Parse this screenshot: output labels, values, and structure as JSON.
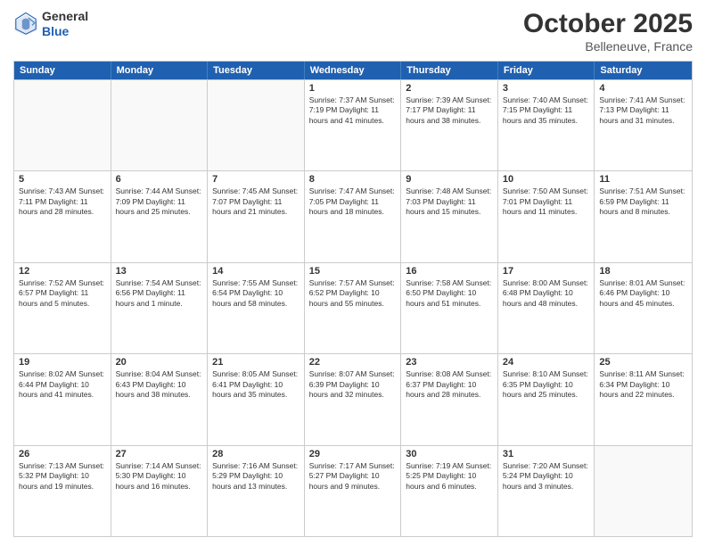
{
  "header": {
    "logo": {
      "general": "General",
      "blue": "Blue"
    },
    "title": "October 2025",
    "location": "Belleneuve, France"
  },
  "days_of_week": [
    "Sunday",
    "Monday",
    "Tuesday",
    "Wednesday",
    "Thursday",
    "Friday",
    "Saturday"
  ],
  "weeks": [
    [
      {
        "day": "",
        "info": ""
      },
      {
        "day": "",
        "info": ""
      },
      {
        "day": "",
        "info": ""
      },
      {
        "day": "1",
        "info": "Sunrise: 7:37 AM\nSunset: 7:19 PM\nDaylight: 11 hours\nand 41 minutes."
      },
      {
        "day": "2",
        "info": "Sunrise: 7:39 AM\nSunset: 7:17 PM\nDaylight: 11 hours\nand 38 minutes."
      },
      {
        "day": "3",
        "info": "Sunrise: 7:40 AM\nSunset: 7:15 PM\nDaylight: 11 hours\nand 35 minutes."
      },
      {
        "day": "4",
        "info": "Sunrise: 7:41 AM\nSunset: 7:13 PM\nDaylight: 11 hours\nand 31 minutes."
      }
    ],
    [
      {
        "day": "5",
        "info": "Sunrise: 7:43 AM\nSunset: 7:11 PM\nDaylight: 11 hours\nand 28 minutes."
      },
      {
        "day": "6",
        "info": "Sunrise: 7:44 AM\nSunset: 7:09 PM\nDaylight: 11 hours\nand 25 minutes."
      },
      {
        "day": "7",
        "info": "Sunrise: 7:45 AM\nSunset: 7:07 PM\nDaylight: 11 hours\nand 21 minutes."
      },
      {
        "day": "8",
        "info": "Sunrise: 7:47 AM\nSunset: 7:05 PM\nDaylight: 11 hours\nand 18 minutes."
      },
      {
        "day": "9",
        "info": "Sunrise: 7:48 AM\nSunset: 7:03 PM\nDaylight: 11 hours\nand 15 minutes."
      },
      {
        "day": "10",
        "info": "Sunrise: 7:50 AM\nSunset: 7:01 PM\nDaylight: 11 hours\nand 11 minutes."
      },
      {
        "day": "11",
        "info": "Sunrise: 7:51 AM\nSunset: 6:59 PM\nDaylight: 11 hours\nand 8 minutes."
      }
    ],
    [
      {
        "day": "12",
        "info": "Sunrise: 7:52 AM\nSunset: 6:57 PM\nDaylight: 11 hours\nand 5 minutes."
      },
      {
        "day": "13",
        "info": "Sunrise: 7:54 AM\nSunset: 6:56 PM\nDaylight: 11 hours\nand 1 minute."
      },
      {
        "day": "14",
        "info": "Sunrise: 7:55 AM\nSunset: 6:54 PM\nDaylight: 10 hours\nand 58 minutes."
      },
      {
        "day": "15",
        "info": "Sunrise: 7:57 AM\nSunset: 6:52 PM\nDaylight: 10 hours\nand 55 minutes."
      },
      {
        "day": "16",
        "info": "Sunrise: 7:58 AM\nSunset: 6:50 PM\nDaylight: 10 hours\nand 51 minutes."
      },
      {
        "day": "17",
        "info": "Sunrise: 8:00 AM\nSunset: 6:48 PM\nDaylight: 10 hours\nand 48 minutes."
      },
      {
        "day": "18",
        "info": "Sunrise: 8:01 AM\nSunset: 6:46 PM\nDaylight: 10 hours\nand 45 minutes."
      }
    ],
    [
      {
        "day": "19",
        "info": "Sunrise: 8:02 AM\nSunset: 6:44 PM\nDaylight: 10 hours\nand 41 minutes."
      },
      {
        "day": "20",
        "info": "Sunrise: 8:04 AM\nSunset: 6:43 PM\nDaylight: 10 hours\nand 38 minutes."
      },
      {
        "day": "21",
        "info": "Sunrise: 8:05 AM\nSunset: 6:41 PM\nDaylight: 10 hours\nand 35 minutes."
      },
      {
        "day": "22",
        "info": "Sunrise: 8:07 AM\nSunset: 6:39 PM\nDaylight: 10 hours\nand 32 minutes."
      },
      {
        "day": "23",
        "info": "Sunrise: 8:08 AM\nSunset: 6:37 PM\nDaylight: 10 hours\nand 28 minutes."
      },
      {
        "day": "24",
        "info": "Sunrise: 8:10 AM\nSunset: 6:35 PM\nDaylight: 10 hours\nand 25 minutes."
      },
      {
        "day": "25",
        "info": "Sunrise: 8:11 AM\nSunset: 6:34 PM\nDaylight: 10 hours\nand 22 minutes."
      }
    ],
    [
      {
        "day": "26",
        "info": "Sunrise: 7:13 AM\nSunset: 5:32 PM\nDaylight: 10 hours\nand 19 minutes."
      },
      {
        "day": "27",
        "info": "Sunrise: 7:14 AM\nSunset: 5:30 PM\nDaylight: 10 hours\nand 16 minutes."
      },
      {
        "day": "28",
        "info": "Sunrise: 7:16 AM\nSunset: 5:29 PM\nDaylight: 10 hours\nand 13 minutes."
      },
      {
        "day": "29",
        "info": "Sunrise: 7:17 AM\nSunset: 5:27 PM\nDaylight: 10 hours\nand 9 minutes."
      },
      {
        "day": "30",
        "info": "Sunrise: 7:19 AM\nSunset: 5:25 PM\nDaylight: 10 hours\nand 6 minutes."
      },
      {
        "day": "31",
        "info": "Sunrise: 7:20 AM\nSunset: 5:24 PM\nDaylight: 10 hours\nand 3 minutes."
      },
      {
        "day": "",
        "info": ""
      }
    ]
  ]
}
